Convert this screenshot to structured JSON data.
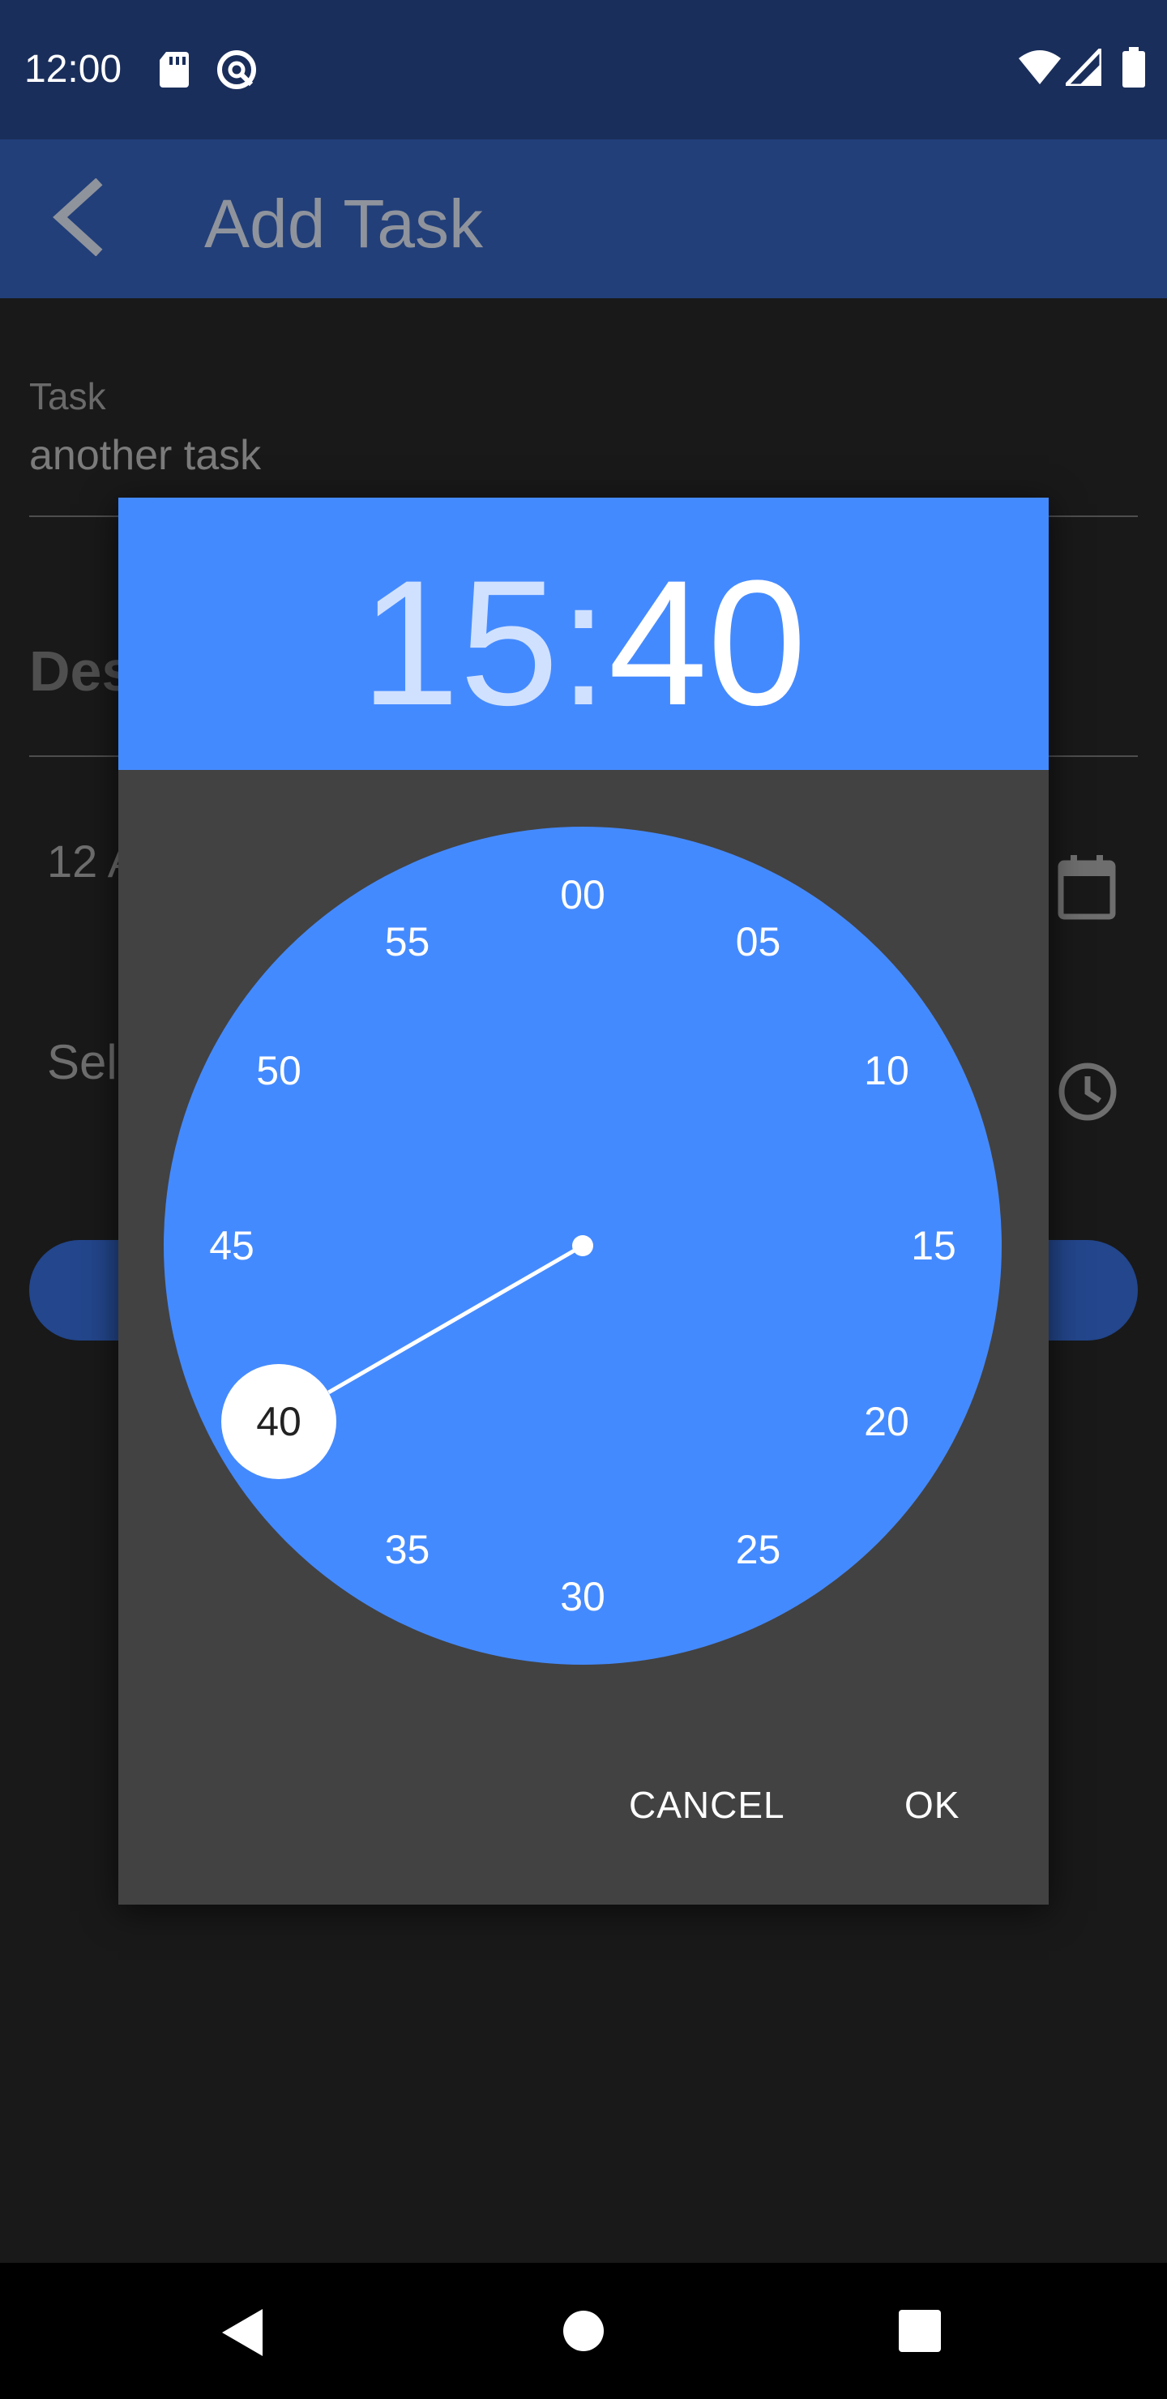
{
  "status_bar": {
    "time": "12:00",
    "icons": [
      "sd-card-icon",
      "sync-icon",
      "wifi-icon",
      "signal-icon",
      "battery-icon"
    ]
  },
  "app_bar": {
    "title": "Add Task",
    "back_icon": "back-arrow-icon"
  },
  "form": {
    "task_label": "Task",
    "task_value": "another task",
    "description_label_visible": "Des",
    "date_value_visible": "12 A",
    "time_value_visible": "Sel",
    "date_icon": "calendar-icon",
    "time_icon": "clock-icon"
  },
  "time_picker": {
    "hour": "15",
    "separator": ":",
    "minute": "40",
    "minute_ticks": [
      "00",
      "05",
      "10",
      "15",
      "20",
      "25",
      "30",
      "35",
      "40",
      "45",
      "50",
      "55"
    ],
    "selected_minute": "40",
    "cancel_label": "CANCEL",
    "ok_label": "OK"
  },
  "colors": {
    "accent": "#448aff",
    "status_bar": "#1a2e5b",
    "app_bar": "#223f79",
    "dialog": "#424242"
  },
  "nav_bar": {
    "icons": [
      "nav-back-icon",
      "nav-home-icon",
      "nav-recents-icon"
    ]
  }
}
